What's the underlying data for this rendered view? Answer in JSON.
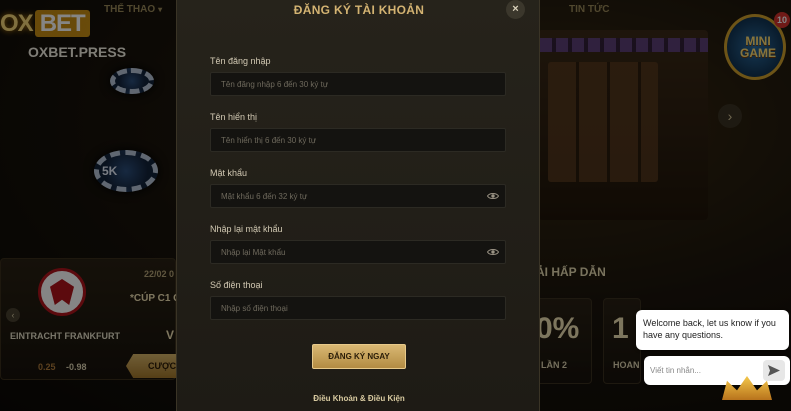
{
  "background": {
    "logo": {
      "main": "OX",
      "bet": "BET",
      "sub": "OXBET.PRESS"
    },
    "nav": {
      "the_thao": "THỂ THAO",
      "tin_tuc": "TIN TỨC"
    },
    "chip_label": "5K",
    "minigame": {
      "text": "MINI GAME",
      "badge": "10"
    },
    "match": {
      "date": "22/02 0",
      "cup": "*CÚP C1 C",
      "club": "EINTRACHT FRANKFURT",
      "v": "V",
      "odd_a": "0.25",
      "odd_b": "-0.98",
      "bet_label": "CƯỢC"
    },
    "promo": {
      "title": "ẢI HẤP DẪN",
      "card1_big": "0%",
      "card1_small": "LẦN 2",
      "card2_big": "1",
      "card2_small": "HOAN"
    }
  },
  "modal": {
    "title": "ĐĂNG KÝ TÀI KHOẢN",
    "close": "×",
    "fields": [
      {
        "label": "Tên đăng nhập",
        "placeholder": "Tên đăng nhập 6 đến 30 ký tự",
        "value": "",
        "type": "text",
        "has_eye": false
      },
      {
        "label": "Tên hiển thị",
        "placeholder": "Tên hiển thị 6 đến 30 ký tự",
        "value": "",
        "type": "text",
        "has_eye": false
      },
      {
        "label": "Mật khẩu",
        "placeholder": "Mật khẩu 6 đến 32 ký tự",
        "value": "",
        "type": "password",
        "has_eye": true
      },
      {
        "label": "Nhập lại mật khẩu",
        "placeholder": "Nhập lại Mật khẩu",
        "value": "",
        "type": "password",
        "has_eye": true
      },
      {
        "label": "Số điện thoại",
        "placeholder": "Nhập số điện thoại",
        "value": "",
        "type": "tel",
        "has_eye": false
      }
    ],
    "submit_label": "ĐĂNG KÝ NGAY",
    "terms_label": "Điều Khoản & Điều Kiện"
  },
  "chat": {
    "message": "Welcome back, let us know if you have any questions.",
    "input_placeholder": "Viết tin nhắn...",
    "send_icon": "send-icon"
  },
  "colors": {
    "accent_gold": "#d3b372",
    "button_gold": "#c9a45c",
    "modal_bg": "#24211a",
    "input_bg": "#141310"
  }
}
